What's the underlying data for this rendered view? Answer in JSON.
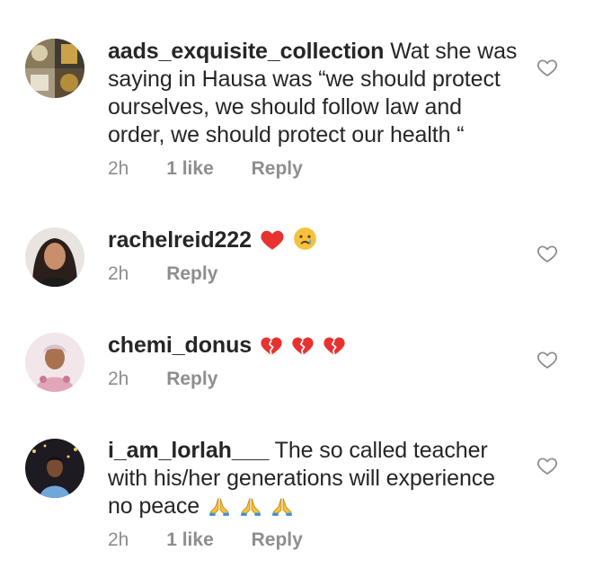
{
  "comments": [
    {
      "username": "aads_exquisite_collection",
      "text": "Wat she was saying in Hausa was “we should protect ourselves, we should follow law and order, we should protect our health “",
      "time": "2h",
      "likes": "1 like",
      "reply": "Reply",
      "avatar_icon": "collage-avatar"
    },
    {
      "username": "rachelreid222",
      "text": "",
      "emojis": [
        "red-heart",
        "crying-face"
      ],
      "time": "2h",
      "reply": "Reply",
      "avatar_icon": "woman-avatar"
    },
    {
      "username": "chemi_donus",
      "text": "",
      "emojis": [
        "broken-heart",
        "broken-heart",
        "broken-heart"
      ],
      "time": "2h",
      "reply": "Reply",
      "avatar_icon": "woman-pink-avatar"
    },
    {
      "username": "i_am_lorlah___",
      "text": "The so called teacher with his/her generations will experience no peace",
      "emojis": [
        "folded-hands",
        "folded-hands",
        "folded-hands"
      ],
      "time": "2h",
      "likes": "1 like",
      "reply": "Reply",
      "avatar_icon": "woman-night-avatar"
    }
  ],
  "colors": {
    "text": "#262626",
    "secondary": "#8e8e8e",
    "heart_red": "#e8322f",
    "emoji_yellow": "#f7c23b"
  }
}
